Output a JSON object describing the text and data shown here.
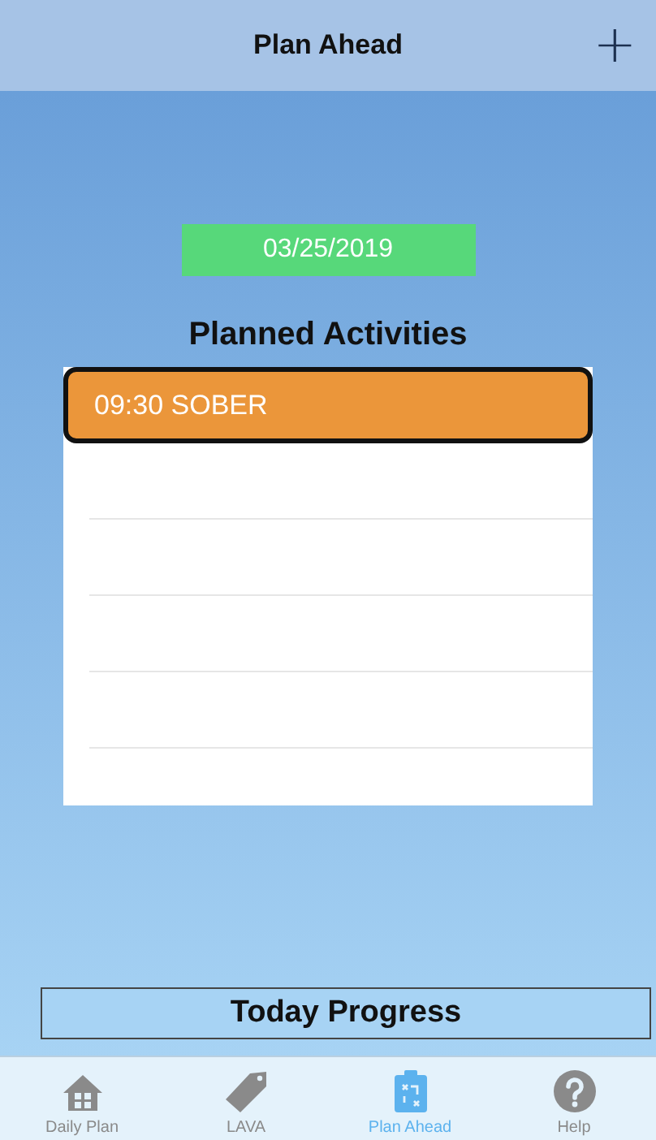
{
  "nav_bar": {
    "title": "Plan Ahead",
    "add_button": "+"
  },
  "date_button": "03/25/2019",
  "planned_activities": {
    "heading": "Planned Activities",
    "items": [
      {
        "label": "09:30 SOBER",
        "selected": true
      }
    ]
  },
  "progress_button": "Today Progress",
  "tabs": [
    {
      "label": "Daily Plan",
      "selected": false
    },
    {
      "label": "LAVA",
      "selected": false
    },
    {
      "label": "Plan Ahead",
      "selected": true
    },
    {
      "label": "Help",
      "selected": false
    }
  ]
}
